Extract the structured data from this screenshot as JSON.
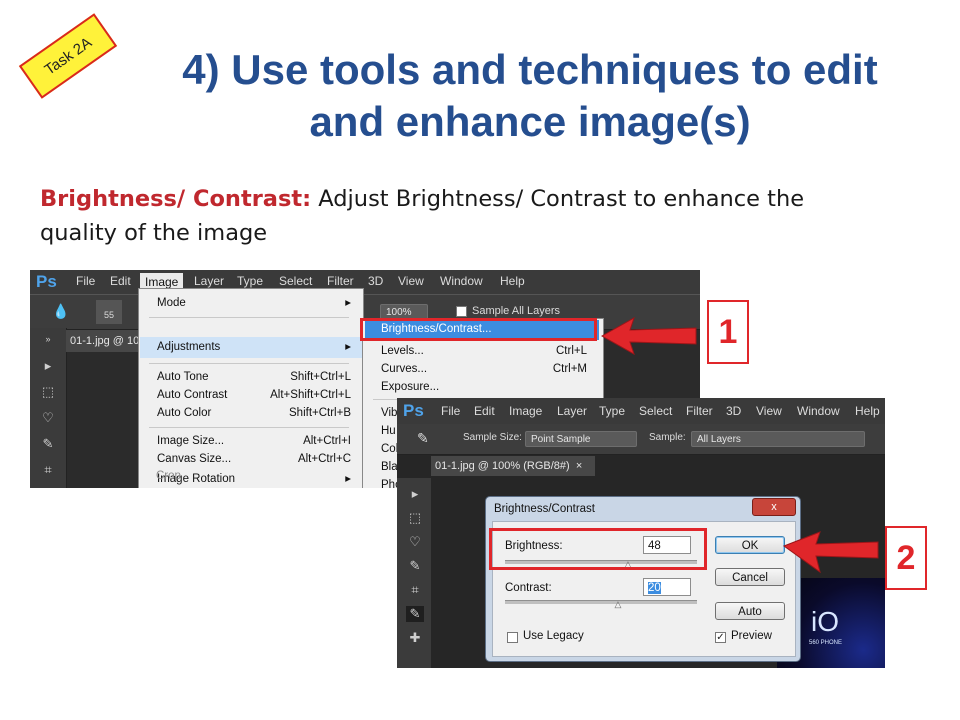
{
  "slide": {
    "task_tag": "Task 2A",
    "title_line1": "4) Use tools and techniques to edit",
    "title_line2": "and enhance image(s)",
    "desc_highlight": "Brightness/ Contrast:",
    "desc_rest": " Adjust Brightness/ Contrast to enhance the",
    "desc_line2": "quality of the image"
  },
  "shot1": {
    "app_logo": "Ps",
    "menus": [
      "File",
      "Edit",
      "Image",
      "Layer",
      "Type",
      "Select",
      "Filter",
      "3D",
      "View",
      "Window",
      "Help"
    ],
    "active_menu": "Image",
    "brush_size": "55",
    "zoom": "100%",
    "sample_all_layers": "Sample All Layers",
    "doc_tab": "01-1.jpg @ 10",
    "image_menu": [
      {
        "label": "Mode",
        "shortcut": "▸"
      },
      {
        "label": "Adjustments",
        "shortcut": "▸"
      },
      {
        "label": "Auto Tone",
        "shortcut": "Shift+Ctrl+L"
      },
      {
        "label": "Auto Contrast",
        "shortcut": "Alt+Shift+Ctrl+L"
      },
      {
        "label": "Auto Color",
        "shortcut": "Shift+Ctrl+B"
      },
      {
        "label": "Image Size...",
        "shortcut": "Alt+Ctrl+I"
      },
      {
        "label": "Canvas Size...",
        "shortcut": "Alt+Ctrl+C"
      },
      {
        "label": "Image Rotation",
        "shortcut": "▸"
      },
      {
        "label": "Crop",
        "shortcut": ""
      }
    ],
    "adjust_menu": [
      {
        "label": "Brightness/Contrast...",
        "shortcut": ""
      },
      {
        "label": "Levels...",
        "shortcut": "Ctrl+L"
      },
      {
        "label": "Curves...",
        "shortcut": "Ctrl+M"
      },
      {
        "label": "Exposure...",
        "shortcut": ""
      },
      {
        "label": "Vib",
        "shortcut": ""
      },
      {
        "label": "Hu",
        "shortcut": ""
      },
      {
        "label": "Col",
        "shortcut": ""
      },
      {
        "label": "Bla",
        "shortcut": ""
      },
      {
        "label": "Pho",
        "shortcut": ""
      }
    ]
  },
  "shot2": {
    "app_logo": "Ps",
    "menus": [
      "File",
      "Edit",
      "Image",
      "Layer",
      "Type",
      "Select",
      "Filter",
      "3D",
      "View",
      "Window",
      "Help"
    ],
    "sample_size_label": "Sample Size:",
    "sample_size_value": "Point Sample",
    "sample_label": "Sample:",
    "sample_value": "All Layers",
    "doc_tab": "01-1.jpg @ 100% (RGB/8#)",
    "doc_tab_close": "×",
    "canvas_text": "iO",
    "canvas_subtext": "560 PHONE",
    "dialog": {
      "title": "Brightness/Contrast",
      "close": "x",
      "brightness_label": "Brightness:",
      "brightness_value": "48",
      "contrast_label": "Contrast:",
      "contrast_value": "20",
      "ok": "OK",
      "cancel": "Cancel",
      "auto": "Auto",
      "use_legacy": "Use Legacy",
      "preview": "Preview"
    }
  },
  "steps": {
    "one": "1",
    "two": "2"
  },
  "colors": {
    "title_blue": "#254e8f",
    "highlight_red": "#c0282e",
    "annotation_red": "#e0262a",
    "task_yellow": "#fff23a",
    "ps_blue": "#4fa3ea"
  }
}
